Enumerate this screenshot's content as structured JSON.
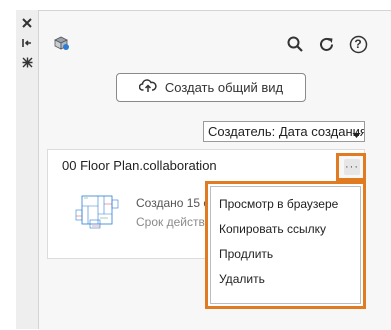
{
  "side_strip": {
    "close_icon": "close-icon",
    "collapse_icon": "collapse-icon",
    "settings_icon": "gear-icon"
  },
  "toolbar": {
    "logo_icon": "collaboration-icon",
    "search_icon": "search-icon",
    "refresh_icon": "refresh-icon",
    "help_icon": "help-icon",
    "help_glyph": "?"
  },
  "create_button": {
    "label": "Создать общий вид",
    "icon": "cloud-upload-icon"
  },
  "sort": {
    "selected": "Создатель: Дата создания"
  },
  "card": {
    "title": "00 Floor Plan.collaboration",
    "created_text": "Создано 15 с",
    "expires_text": "Срок действ",
    "more_label": "···"
  },
  "context_menu": {
    "items": [
      "Просмотр в браузере",
      "Копировать ссылку",
      "Продлить",
      "Удалить"
    ]
  },
  "colors": {
    "highlight": "#e07b21",
    "panel_bg": "#f7f7f7",
    "strip_bg": "#eeeeee",
    "accent_blue": "#2d7dd2"
  }
}
